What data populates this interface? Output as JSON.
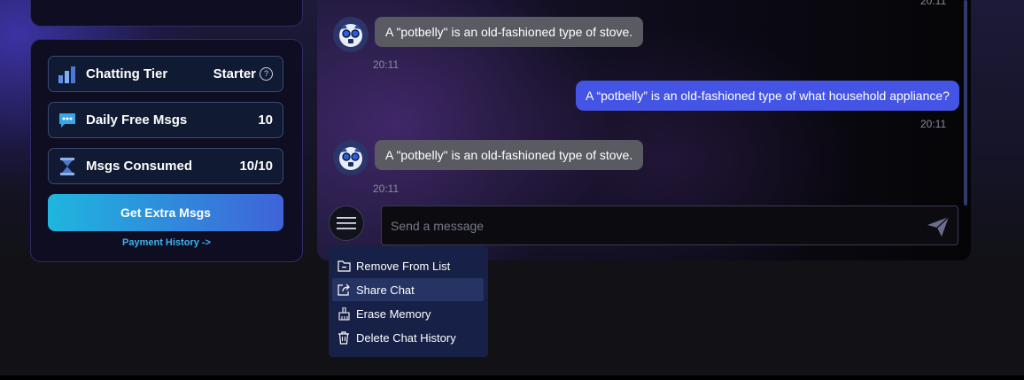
{
  "sidebar": {
    "stats": [
      {
        "label": "Chatting Tier",
        "value": "Starter",
        "icon": "bar-chart-icon"
      },
      {
        "label": "Daily Free Msgs",
        "value": "10",
        "icon": "chat-bubble-icon"
      },
      {
        "label": "Msgs Consumed",
        "value": "10/10",
        "icon": "hourglass-icon"
      }
    ],
    "help_glyph": "?",
    "extra_button": "Get Extra Msgs",
    "payment_link": "Payment History ->"
  },
  "chat": {
    "top_time": "20:11",
    "messages": [
      {
        "sender": "bot",
        "text": "A \"potbelly\" is an old-fashioned type of stove.",
        "time": "20:11"
      },
      {
        "sender": "user",
        "text": "A “potbelly” is an old-fashioned type of what household appliance?",
        "time": "20:11"
      },
      {
        "sender": "bot",
        "text": "A \"potbelly\" is an old-fashioned type of stove.",
        "time": "20:11"
      }
    ],
    "input_placeholder": "Send a message"
  },
  "menu": {
    "items": [
      {
        "label": "Remove From List",
        "icon": "folder-minus-icon"
      },
      {
        "label": "Share Chat",
        "icon": "share-icon",
        "active": true
      },
      {
        "label": "Erase Memory",
        "icon": "broom-icon"
      },
      {
        "label": "Delete Chat History",
        "icon": "trash-icon"
      }
    ]
  },
  "colors": {
    "accent_user_bubble": "#4455e6",
    "button_gradient_start": "#1fb6df",
    "button_gradient_end": "#3f63d8",
    "link": "#39b4f0"
  }
}
